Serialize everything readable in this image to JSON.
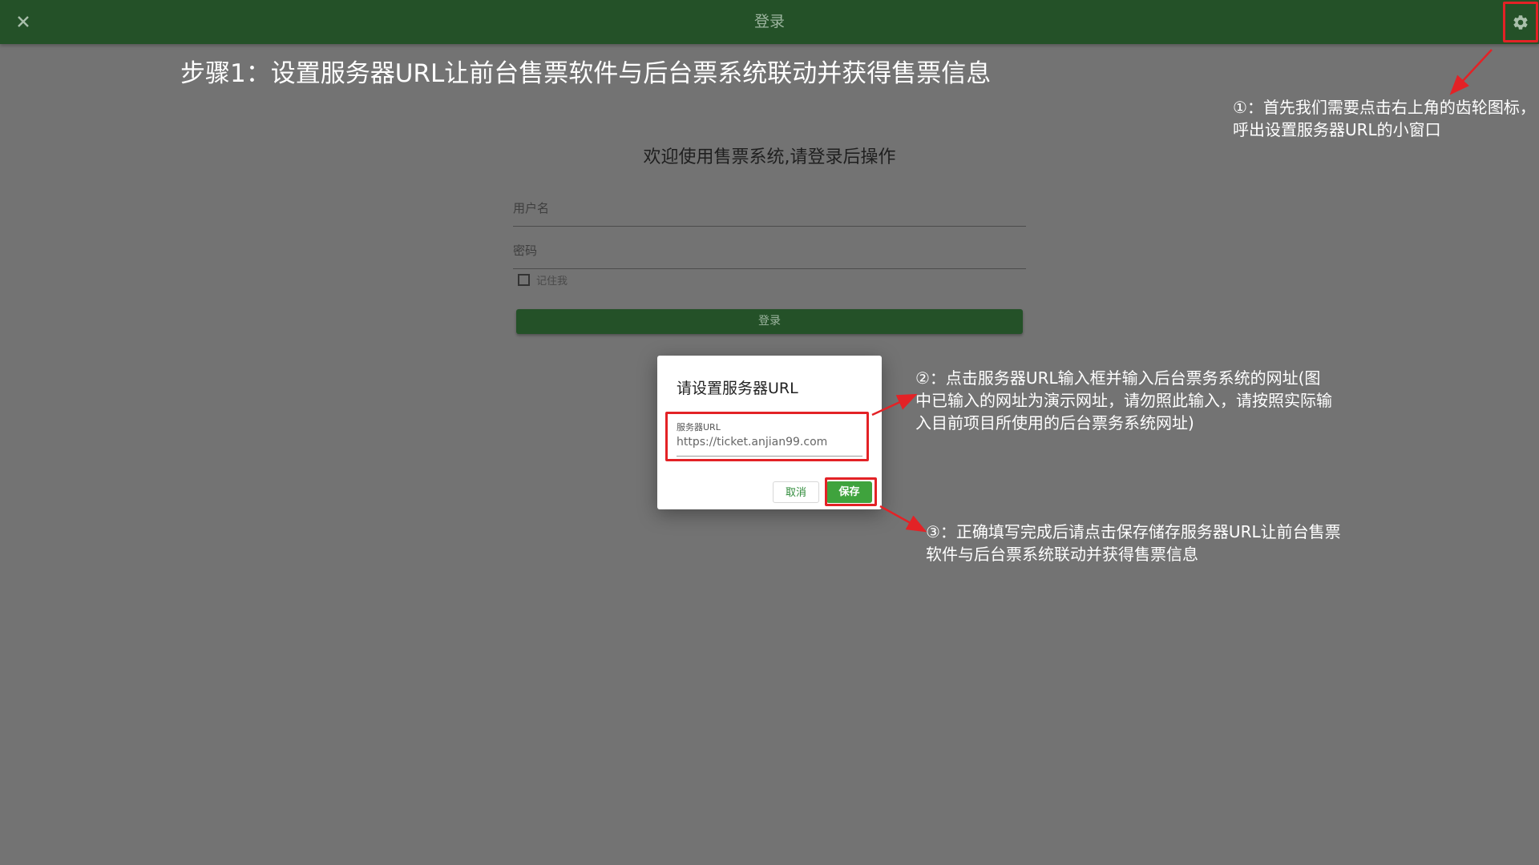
{
  "app": {
    "title": "登录"
  },
  "annotation": {
    "heading": "步骤1：设置服务器URL让前台售票软件与后台票系统联动并获得售票信息",
    "note1": "①：首先我们需要点击右上角的齿轮图标，呼出设置服务器URL的小窗口",
    "note2": "②：点击服务器URL输入框并输入后台票务系统的网址(图中已输入的网址为演示网址，请勿照此输入，请按照实际输入目前项目所使用的后台票务系统网址)",
    "note3": "③：正确填写完成后请点击保存储存服务器URL让前台售票软件与后台票系统联动并获得售票信息"
  },
  "login": {
    "welcome": "欢迎使用售票系统,请登录后操作",
    "username_placeholder": "用户名",
    "password_placeholder": "密码",
    "remember_label": "记住我",
    "remember_checked": false,
    "submit_label": "登录"
  },
  "dialog": {
    "title": "请设置服务器URL",
    "url_label": "服务器URL",
    "url_value": "https://ticket.anjian99.com",
    "cancel_label": "取消",
    "save_label": "保存"
  },
  "icons": {
    "close": "close-icon",
    "settings": "gear-icon"
  },
  "colors": {
    "topbar": "#245128",
    "backdrop": "#737373",
    "annotation_red": "#e32226",
    "save_button": "#3fa33d"
  }
}
